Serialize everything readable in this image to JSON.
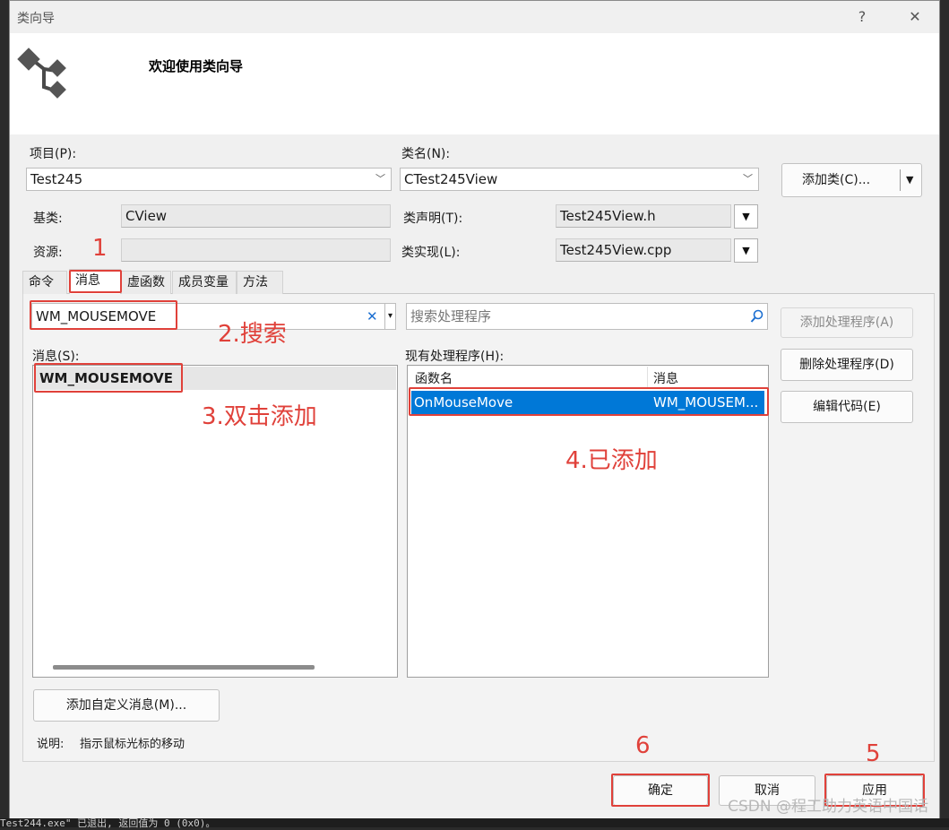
{
  "window": {
    "title": "类向导",
    "help_glyph": "?",
    "close_glyph": "✕"
  },
  "header": {
    "title": "欢迎使用类向导",
    "icon": "class-wizard-icon"
  },
  "form": {
    "project_label": "项目(P):",
    "project_value": "Test245",
    "classname_label": "类名(N):",
    "classname_value": "CTest245View",
    "add_class_label": "添加类(C)...",
    "base_label": "基类:",
    "base_value": "CView",
    "resource_label": "资源:",
    "resource_value": "",
    "decl_label": "类声明(T):",
    "decl_value": "Test245View.h",
    "impl_label": "类实现(L):",
    "impl_value": "Test245View.cpp"
  },
  "tabs": [
    {
      "label": "命令"
    },
    {
      "label": "消息"
    },
    {
      "label": "虚函数"
    },
    {
      "label": "成员变量"
    },
    {
      "label": "方法"
    }
  ],
  "messages_tab": {
    "search_value": "WM_MOUSEMOVE",
    "handler_search_placeholder": "搜索处理程序",
    "messages_label": "消息(S):",
    "messages": [
      "WM_MOUSEMOVE"
    ],
    "handlers_label": "现有处理程序(H):",
    "handler_columns": [
      "函数名",
      "消息"
    ],
    "handlers": [
      {
        "function": "OnMouseMove",
        "message": "WM_MOUSEM..."
      }
    ],
    "add_handler_label": "添加处理程序(A)",
    "delete_handler_label": "删除处理程序(D)",
    "edit_code_label": "编辑代码(E)",
    "add_custom_label": "添加自定义消息(M)...",
    "description_label": "说明:",
    "description_value": "指示鼠标光标的移动"
  },
  "footer": {
    "ok_label": "确定",
    "cancel_label": "取消",
    "apply_label": "应用"
  },
  "annotations": {
    "n1": "1",
    "n2": "2.搜索",
    "n3": "3.双击添加",
    "n4": "4.已添加",
    "n5": "5",
    "n6": "6"
  },
  "watermark": "CSDN @程工助力英语中国话",
  "console_text": "Test244.exe\" 已退出, 返回值为 0 (0x0)。",
  "colors": {
    "annotation_red": "#e0413a",
    "selection_blue": "#0078d7",
    "dialog_bg": "#f0f0f0"
  }
}
